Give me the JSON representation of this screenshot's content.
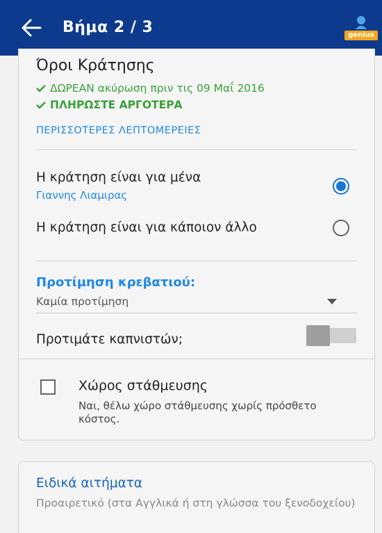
{
  "appbar": {
    "title": "Βήμα 2 / 3",
    "genius_badge": "genius",
    "color": "#0d3a8c"
  },
  "conditions": {
    "heading": "Όροι Κράτησης",
    "items": [
      "ΔΩΡΕΑΝ ακύρωση πριν τις 09 Μαΐ 2016",
      "ΠΛΗΡΩΣΤΕ ΑΡΓΟΤΕΡΑ"
    ],
    "more_link": "ΠΕΡΙΣΣΟΤΕΡΕΣ ΛΕΠΤΟΜΕΡΕΙΕΣ"
  },
  "booking_for": {
    "options": [
      {
        "label": "Η κράτηση είναι για μένα",
        "sub": "Γιαννης Λιαμιρας",
        "selected": true
      },
      {
        "label": "Η κράτηση είναι για κάποιον άλλο",
        "selected": false
      }
    ]
  },
  "bed_preference": {
    "label": "Προτίμηση κρεβατιού:",
    "value": "Καμία προτίμηση"
  },
  "smoking": {
    "label": "Προτιμάτε καπνιστών;",
    "enabled": false
  },
  "parking": {
    "label": "Χώρος στάθμευσης",
    "description": "Ναι, θέλω χώρο στάθμευσης χωρίς πρόσθετο κόστος.",
    "checked": false
  },
  "special_requests": {
    "label": "Ειδικά αιτήματα",
    "hint": "Προαιρετικό (στα Αγγλικά ή στη γλώσσα του ξενοδοχείου)"
  },
  "colors": {
    "accent": "#1e88e5",
    "success": "#3aa03a",
    "genius": "#f5a71b"
  }
}
